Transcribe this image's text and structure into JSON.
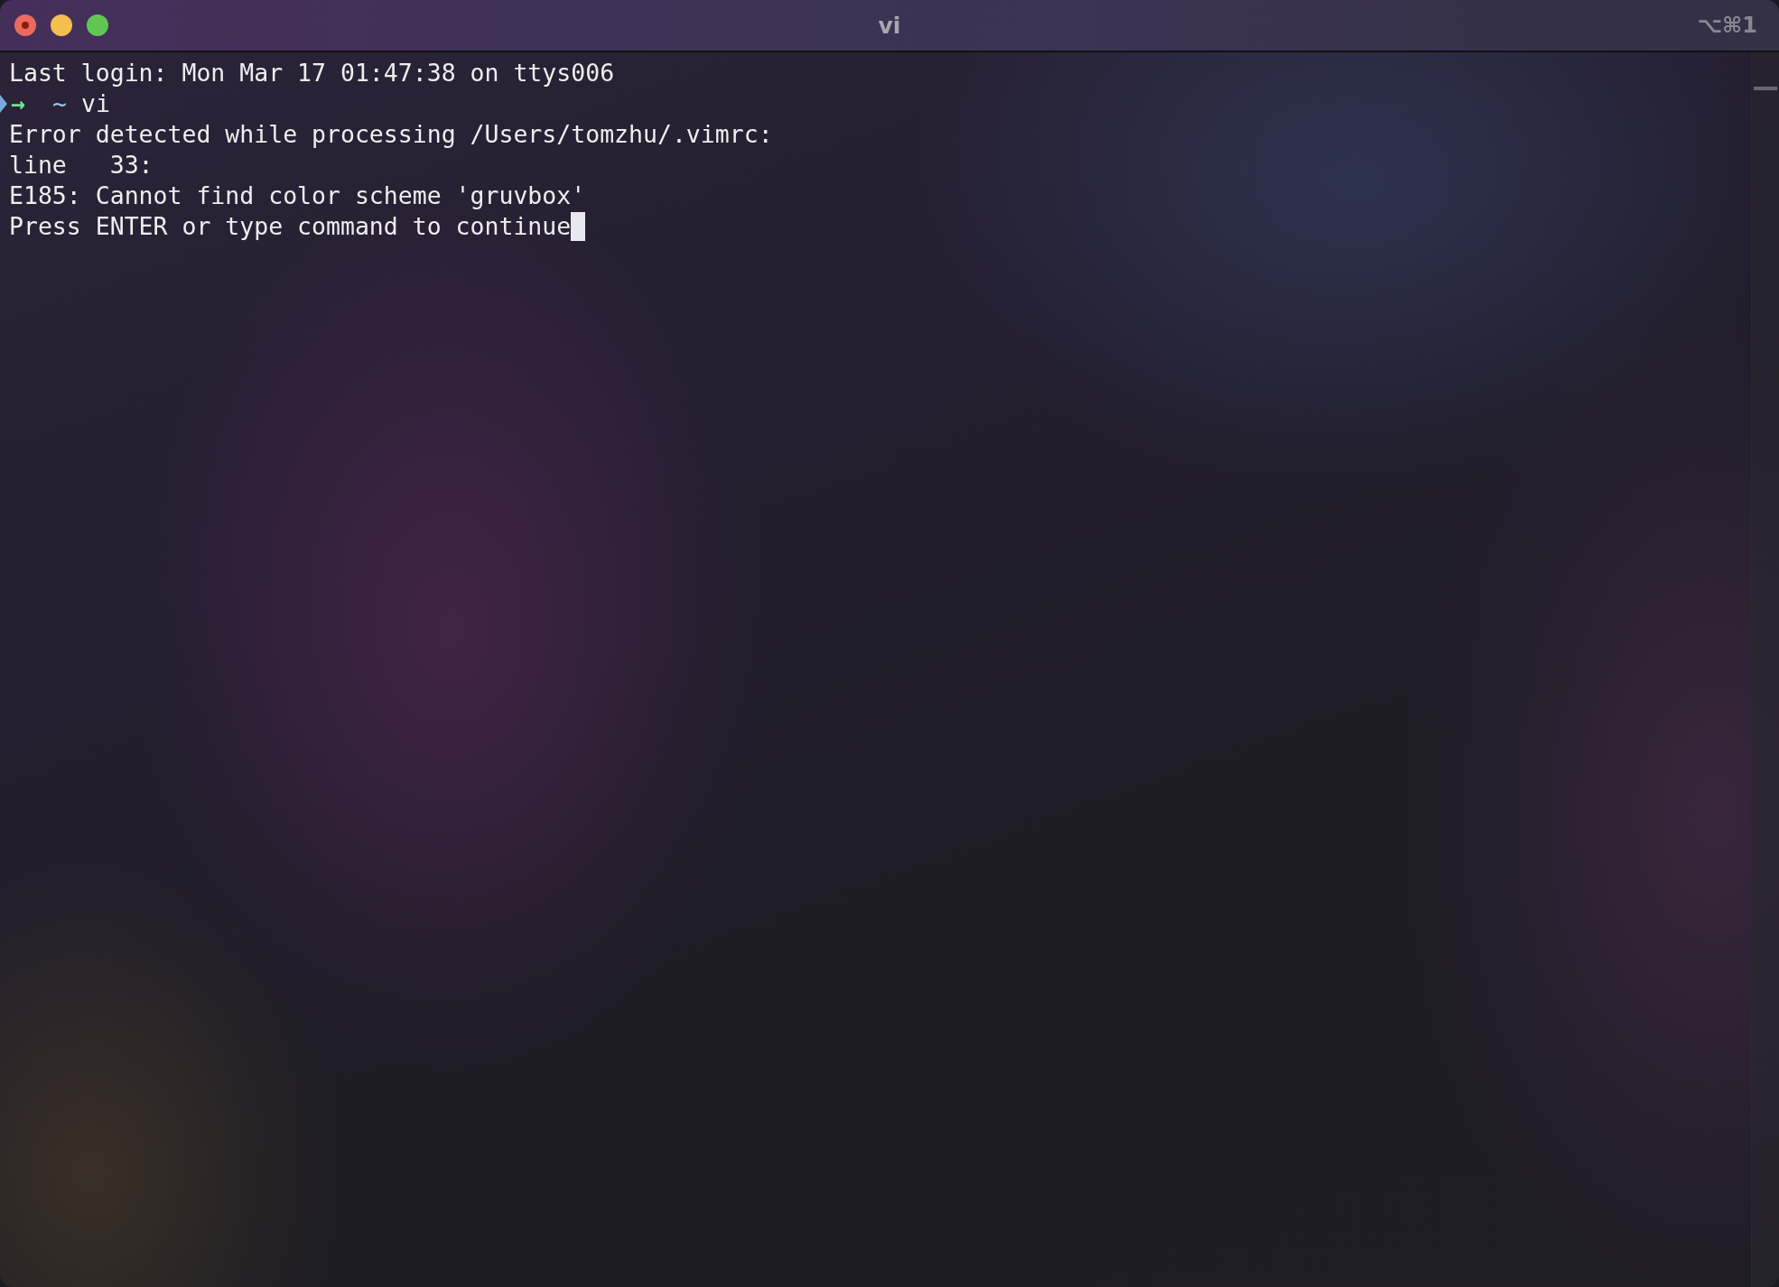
{
  "window": {
    "title": "vi",
    "shortcut": "⌥⌘1"
  },
  "lines": [
    {
      "kind": "text",
      "text": "Last login: Mon Mar 17 01:47:38 on ttys006",
      "cursor": false
    },
    {
      "kind": "prompt",
      "arrow": "→",
      "cwd": "~",
      "command": "vi",
      "cursor": false
    },
    {
      "kind": "text",
      "text": "Error detected while processing /Users/tomzhu/.vimrc:",
      "cursor": false
    },
    {
      "kind": "text",
      "text": "line   33:",
      "cursor": false
    },
    {
      "kind": "text",
      "text": "E185: Cannot find color scheme 'gruvbox'",
      "cursor": false
    },
    {
      "kind": "text",
      "text": "Press ENTER or type command to continue",
      "cursor": true
    }
  ]
}
